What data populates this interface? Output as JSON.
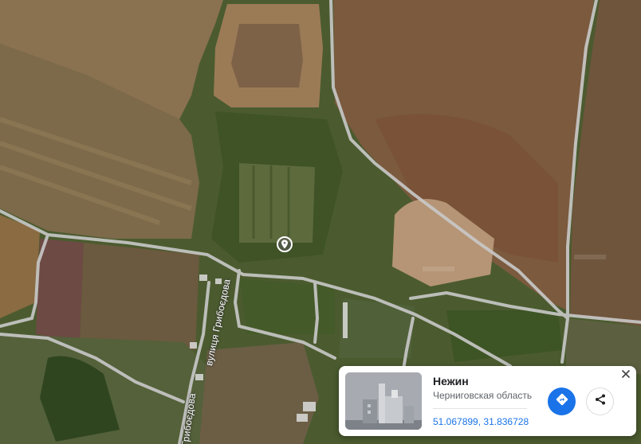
{
  "map": {
    "street_labels": [
      "вулиця Грибоєдова",
      "Грибоєдова"
    ],
    "marker_icon": "place-pin-icon"
  },
  "place_card": {
    "title": "Нежин",
    "region": "Черниговская область",
    "coordinates": "51.067899, 31.836728",
    "directions_icon": "directions-icon",
    "share_icon": "share-icon",
    "close_icon": "close-icon"
  },
  "colors": {
    "accent": "#1a73e8",
    "road": "#c9c9c9"
  }
}
